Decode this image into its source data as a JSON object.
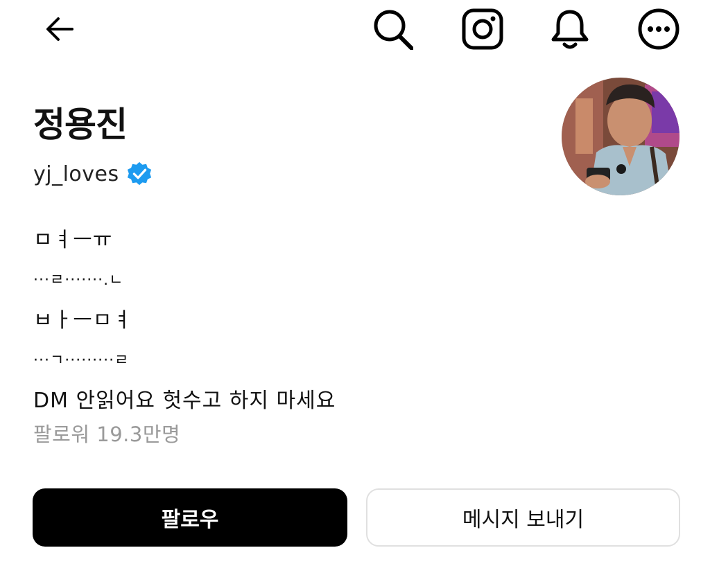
{
  "header": {
    "icons": [
      "back-arrow-icon",
      "search-icon",
      "instagram-icon",
      "bell-icon",
      "more-icon"
    ]
  },
  "profile": {
    "display_name": "정용진",
    "username": "yj_loves",
    "verified": true,
    "verified_color": "#1D9BF0"
  },
  "bio": {
    "lines": [
      "ㅁㅕㅡㅠ",
      "···ㄹ·······.ㄴ",
      "ㅂㅏㅡㅁㅕ",
      "···ㄱ·········ㄹ",
      "DM 안읽어요 헛수고 하지 마세요"
    ]
  },
  "stats": {
    "followers": "팔로워 19.3만명"
  },
  "actions": {
    "follow_label": "팔로우",
    "message_label": "메시지 보내기"
  }
}
